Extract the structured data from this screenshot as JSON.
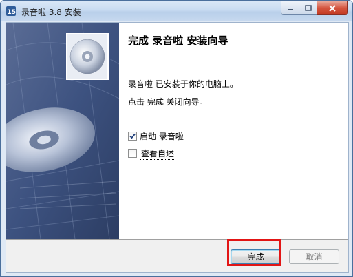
{
  "window": {
    "title": "录音啦 3.8 安装"
  },
  "content": {
    "heading": "完成 录音啦 安装向导",
    "installed_text": "录音啦 已安装于你的电脑上。",
    "instruction_text": "点击 完成 关闭向导。"
  },
  "options": [
    {
      "label": "启动 录音啦",
      "checked": true
    },
    {
      "label": "查看自述",
      "checked": false
    }
  ],
  "buttons": {
    "finish_label": "完成",
    "cancel_label": "取消"
  },
  "colors": {
    "highlight": "#e21515",
    "banner": "#3a4f78"
  }
}
